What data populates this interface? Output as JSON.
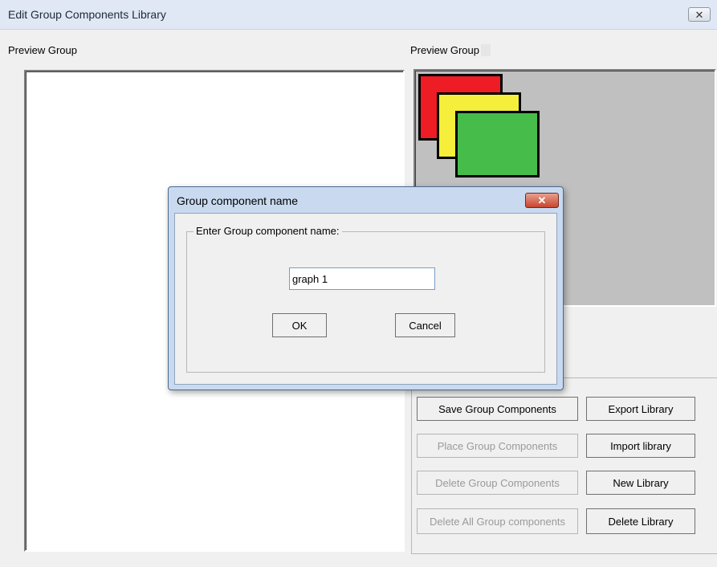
{
  "window": {
    "title": "Edit Group Components Library",
    "close_glyph": "✕"
  },
  "left_panel": {
    "label": "Preview Group"
  },
  "right_panel": {
    "label": "Preview Group"
  },
  "buttons": {
    "save": "Save Group Components",
    "place": "Place Group Components",
    "delete": "Delete Group Components",
    "delete_all": "Delete All Group components",
    "export": "Export Library",
    "import": "Import library",
    "new": "New Library",
    "delete_library": "Delete Library"
  },
  "dialog": {
    "title": "Group component name",
    "close_glyph": "✕",
    "legend": "Enter Group component name:",
    "input_value": "graph 1",
    "ok": "OK",
    "cancel": "Cancel"
  },
  "colors": {
    "red": "#ee1c24",
    "yellow": "#f5ee3a",
    "green": "#46bd4a",
    "preview_bg": "#c0c0c0"
  }
}
